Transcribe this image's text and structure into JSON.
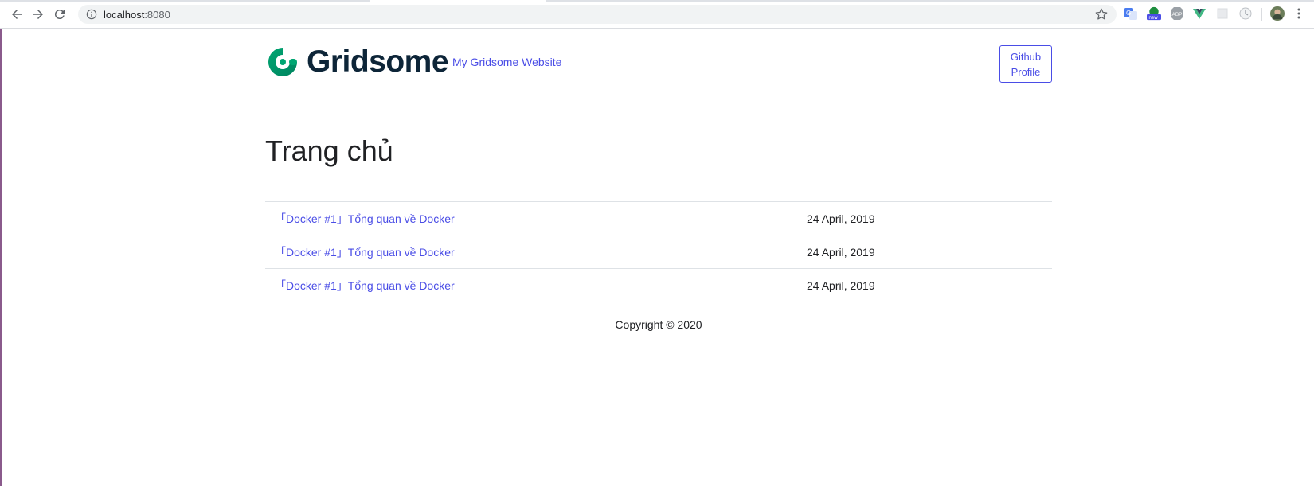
{
  "browser": {
    "url_host": "localhost",
    "url_port": ":8080",
    "extensions": [
      {
        "name": "translate-icon"
      },
      {
        "name": "new-badge-extension-icon",
        "badge": "new"
      },
      {
        "name": "adblock-icon",
        "label": "ABP"
      },
      {
        "name": "vue-devtools-icon"
      },
      {
        "name": "blank-extension-icon"
      },
      {
        "name": "clock-extension-icon"
      }
    ]
  },
  "header": {
    "logo_text": "Gridsome",
    "site_name": "My Gridsome Website",
    "github_button": "Github Profile"
  },
  "main": {
    "title": "Trang chủ",
    "posts": [
      {
        "title": "「Docker #1」Tổng quan về Docker",
        "date": "24 April, 2019"
      },
      {
        "title": "「Docker #1」Tổng quan về Docker",
        "date": "24 April, 2019"
      },
      {
        "title": "「Docker #1」Tổng quan về Docker",
        "date": "24 April, 2019"
      }
    ]
  },
  "footer": {
    "copyright": "Copyright © 2020"
  },
  "colors": {
    "accent": "#4a4de6",
    "logo_dark": "#0d2538",
    "logo_green": "#00a672"
  }
}
